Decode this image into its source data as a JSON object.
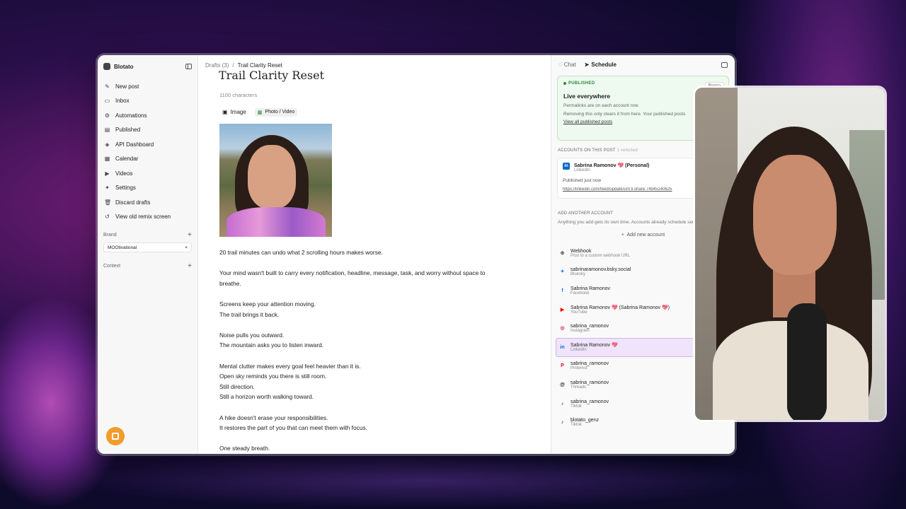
{
  "sidebar": {
    "app_name": "Blotato",
    "items": [
      {
        "label": "New post",
        "icon": "✎"
      },
      {
        "label": "Inbox",
        "icon": "▭"
      },
      {
        "label": "Automations",
        "icon": "⚙"
      },
      {
        "label": "Published",
        "icon": "▤"
      },
      {
        "label": "API Dashboard",
        "icon": "◈"
      },
      {
        "label": "Calendar",
        "icon": "▦"
      },
      {
        "label": "Videos",
        "icon": "▶"
      },
      {
        "label": "Settings",
        "icon": "✦"
      },
      {
        "label": "Discard drafts",
        "icon": "🗑"
      },
      {
        "label": "View old remix screen",
        "icon": "↺"
      }
    ],
    "brand_label": "Brand",
    "brand_chip": "MOOtivational",
    "context_label": "Context"
  },
  "main": {
    "breadcrumb_root": "Drafts (3)",
    "breadcrumb_sep": "/",
    "breadcrumb_current": "Trail Clarity Reset",
    "title": "Trail Clarity Reset",
    "char_count": "1100 characters",
    "media_tabs": [
      "Image",
      "Photo / Video"
    ],
    "paragraphs": [
      [
        "20 trail minutes can undo what 2 scrolling hours makes worse."
      ],
      [
        "Your mind wasn't built to carry every notification, headline, message, task, and worry without space to",
        "breathe."
      ],
      [
        "Screens keep your attention moving.",
        "The trail brings it back."
      ],
      [
        "Noise pulls you outward.",
        "The mountain asks you to listen inward."
      ],
      [
        "Mental clutter makes every goal feel heavier than it is.",
        "Open sky reminds you there is still room.",
        "Still direction.",
        "Still a horizon worth walking toward."
      ],
      [
        "A hike doesn't erase your responsibilities.",
        "It restores the part of you that can meet them with focus."
      ],
      [
        "One steady breath."
      ]
    ]
  },
  "right": {
    "tab_chat": "Chat",
    "tab_schedule": "Schedule",
    "published_badge": "PUBLISHED",
    "remove_label": "Remo",
    "live_title": "Live everywhere",
    "live_sub1": "Permalinks are on each account row.",
    "live_sub2": "Removing this only clears it from here. Your published posts",
    "view_all": "View all published posts",
    "accounts_label": "ACCOUNTS ON THIS POST",
    "accounts_count": "1 selected",
    "account": {
      "name": "Sabrina Ramonov 💖 (Personal)",
      "platform": "LinkedIn",
      "status": "Published just now",
      "url": "https://linkedin.com/feed/update/urn:li:share:74945140625"
    },
    "add_label": "ADD ANOTHER ACCOUNT",
    "add_sub": "Anything you add gets its own time. Accounts already schedule send.",
    "add_button": "Add new account",
    "platforms": [
      {
        "icon": "⊕",
        "color": "#555555",
        "name": "Webhook",
        "platform": "Post to a custom webhook URL",
        "selected": false
      },
      {
        "icon": "✦",
        "color": "#1185fe",
        "name": "sabrinaramonov.bsky.social",
        "platform": "Bluesky",
        "selected": false
      },
      {
        "icon": "f",
        "color": "#1877f2",
        "name": "Sabrina Ramonov",
        "platform": "Facebook",
        "selected": false
      },
      {
        "icon": "▶",
        "color": "#ff0000",
        "name": "Sabrina Ramonov 💖 (Sabrina Ramonov 💖)",
        "platform": "YouTube",
        "selected": false
      },
      {
        "icon": "◎",
        "color": "#d62976",
        "name": "sabrina_ramonov",
        "platform": "Instagram",
        "selected": false
      },
      {
        "icon": "in",
        "color": "#0a66c2",
        "name": "Sabrina Ramonov 💖",
        "platform": "LinkedIn",
        "selected": true
      },
      {
        "icon": "P",
        "color": "#e60023",
        "name": "sabrina_ramonov",
        "platform": "Pinterest",
        "selected": false
      },
      {
        "icon": "@",
        "color": "#111111",
        "name": "sabrina_ramonov",
        "platform": "Threads",
        "selected": false
      },
      {
        "icon": "♪",
        "color": "#111111",
        "name": "sabrina_ramonov",
        "platform": "Tiktok",
        "selected": false
      },
      {
        "icon": "♪",
        "color": "#111111",
        "name": "blotato_genz",
        "platform": "Tiktok",
        "selected": false
      }
    ]
  }
}
